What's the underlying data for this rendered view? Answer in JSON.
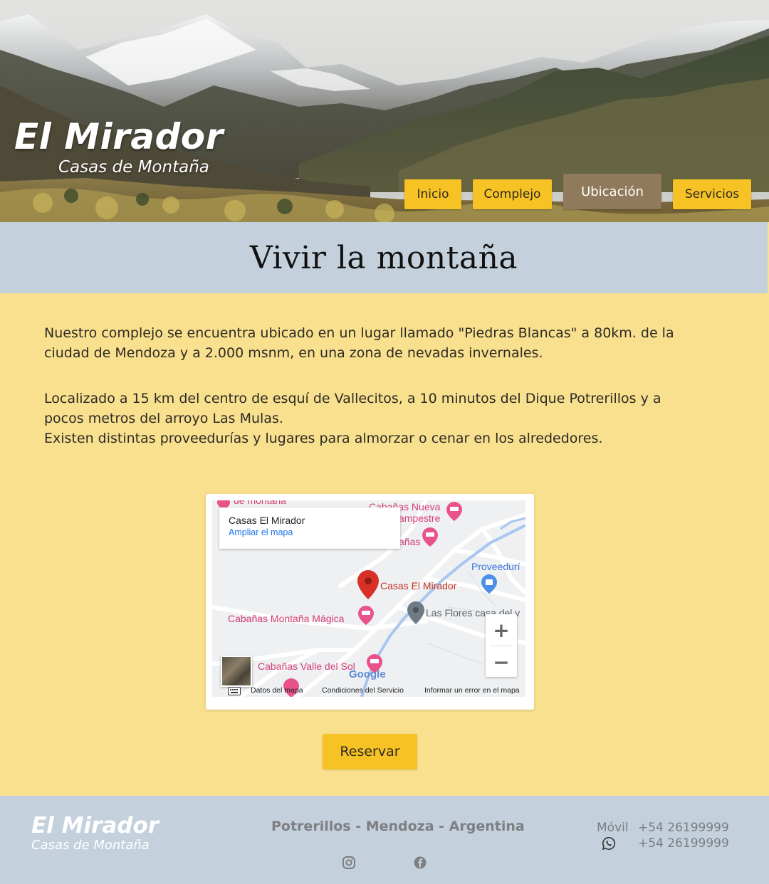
{
  "header": {
    "brand_title": "El Mirador",
    "brand_subtitle": "Casas de Montaña",
    "nav": [
      {
        "label": "Inicio",
        "active": false
      },
      {
        "label": "Complejo",
        "active": false
      },
      {
        "label": "Ubicación",
        "active": true
      },
      {
        "label": "Servicios",
        "active": false
      }
    ]
  },
  "band": {
    "title": "Vivir la montaña"
  },
  "content": {
    "paragraph1": "Nuestro complejo se encuentra ubicado en un lugar llamado \"Piedras Blancas\" a 80km. de la ciudad de Mendoza y a 2.000 msnm, en una zona de nevadas invernales.",
    "paragraph2_line1": "Localizado a 15 km del centro de esquí de Vallecitos, a 10 minutos del Dique Potrerillos y a pocos metros del arroyo Las Mulas.",
    "paragraph2_line2": "Existen distintas proveedurías y lugares para almorzar o cenar en los alrededores."
  },
  "map": {
    "place_name": "Casas El Mirador",
    "enlarge_link": "Ampliar el mapa",
    "labels": {
      "top_partial": "de montaña",
      "nueva_line1": "Cabañas Nueva",
      "nueva_line2": "ampestre",
      "anas": "añas",
      "proveeduria": "Proveedurí",
      "marker": "Casas El Mirador",
      "las_flores": "Las Flores casa del v",
      "montana_magica": "Cabañas Montaña Mágica",
      "valle_del_sol": "Cabañas Valle del Sol"
    },
    "zoom_in": "+",
    "zoom_out": "−",
    "google": "Google",
    "attribution": {
      "map_data": "Datos del mapa",
      "terms": "Condiciones del Servicio",
      "report": "Informar un error en el mapa"
    }
  },
  "reserve_button": "Reservar",
  "footer": {
    "brand_title": "El Mirador",
    "brand_subtitle": "Casas de Montaña",
    "location": "Potrerillos - Mendoza - Argentina",
    "mobile_label": "Móvil",
    "mobile_number": "+54 26199999",
    "whatsapp_number": "+54 26199999",
    "icons": [
      "instagram-icon",
      "facebook-icon",
      "whatsapp-icon"
    ]
  },
  "colors": {
    "accent_yellow": "#f6c224",
    "active_nav": "#8f7a5c",
    "band_blue": "#c4d1dc",
    "page_background": "#f9e08e",
    "map_pink": "#d63d74",
    "map_red_marker": "#d93025"
  }
}
